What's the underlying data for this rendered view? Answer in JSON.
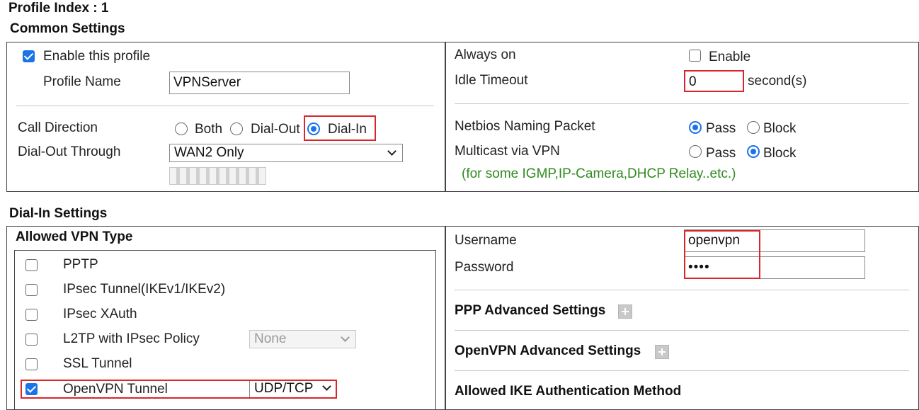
{
  "profile_index": "Profile Index : 1",
  "common": {
    "heading": "Common Settings",
    "enable_label": "Enable this profile",
    "profile_name_label": "Profile Name",
    "profile_name_value": "VPNServer",
    "call_direction_label": "Call Direction",
    "call_direction_options": [
      "Both",
      "Dial-Out",
      "Dial-In"
    ],
    "call_direction_selected": "Dial-In",
    "dial_out_through_label": "Dial-Out Through",
    "dial_out_through_value": "WAN2 Only",
    "always_on_label": "Always on",
    "always_on_enable_label": "Enable",
    "idle_timeout_label": "Idle Timeout",
    "idle_timeout_value": "0",
    "idle_timeout_unit": "second(s)",
    "netbios_label": "Netbios Naming Packet",
    "netbios_options": [
      "Pass",
      "Block"
    ],
    "netbios_selected": "Pass",
    "multicast_label": "Multicast via VPN",
    "multicast_options": [
      "Pass",
      "Block"
    ],
    "multicast_selected": "Block",
    "multicast_note": "(for some IGMP,IP-Camera,DHCP Relay..etc.)"
  },
  "dialin": {
    "heading": "Dial-In Settings",
    "allowed_vpn_heading": "Allowed VPN Type",
    "vpn_types": [
      {
        "label": "PPTP",
        "checked": false
      },
      {
        "label": "IPsec Tunnel(IKEv1/IKEv2)",
        "checked": false
      },
      {
        "label": "IPsec XAuth",
        "checked": false
      },
      {
        "label": "L2TP with IPsec Policy",
        "checked": false
      },
      {
        "label": "SSL Tunnel",
        "checked": false
      },
      {
        "label": "OpenVPN Tunnel",
        "checked": true
      }
    ],
    "l2tp_policy_value": "None",
    "openvpn_protocol_value": "UDP/TCP",
    "username_label": "Username",
    "username_value": "openvpn",
    "password_label": "Password",
    "password_value": "••••",
    "ppp_advanced_label": "PPP Advanced Settings",
    "openvpn_advanced_label": "OpenVPN Advanced Settings",
    "ike_auth_label": "Allowed IKE Authentication Method"
  }
}
